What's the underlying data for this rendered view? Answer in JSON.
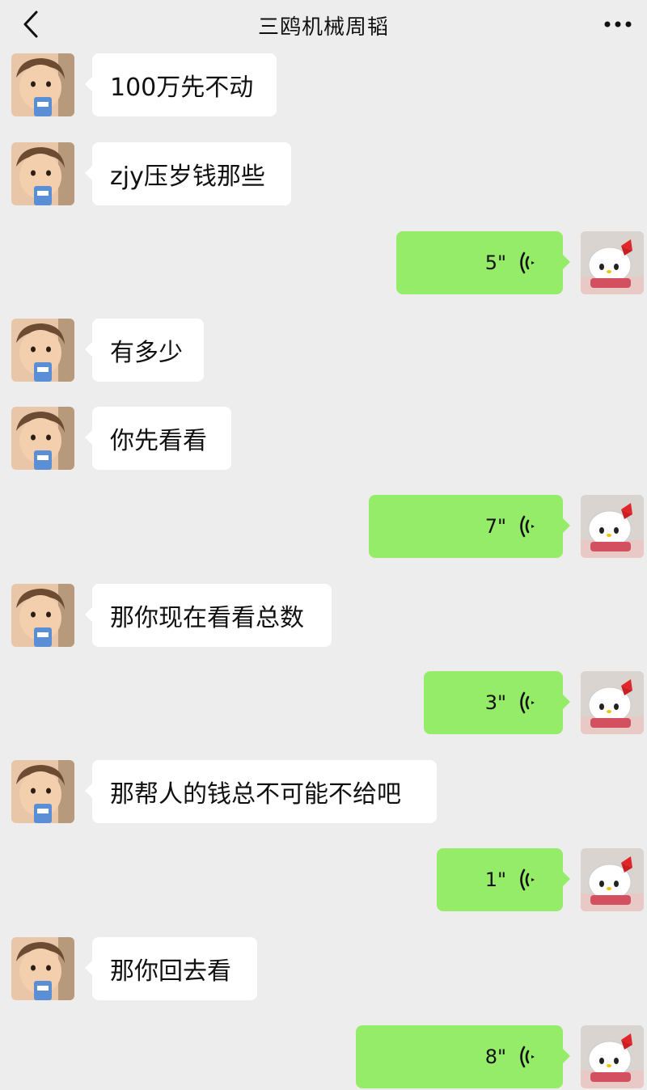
{
  "header": {
    "title": "三鸥机械周韬"
  },
  "messages": [
    {
      "side": "left",
      "type": "text",
      "text": "100万先不动"
    },
    {
      "side": "left",
      "type": "text",
      "text": "zjy压岁钱那些"
    },
    {
      "side": "right",
      "type": "voice",
      "duration": "5\""
    },
    {
      "side": "left",
      "type": "text",
      "text": "有多少"
    },
    {
      "side": "left",
      "type": "text",
      "text": "你先看看"
    },
    {
      "side": "right",
      "type": "voice",
      "duration": "7\""
    },
    {
      "side": "left",
      "type": "text",
      "text": "那你现在看看总数"
    },
    {
      "side": "right",
      "type": "voice",
      "duration": "3\""
    },
    {
      "side": "left",
      "type": "text",
      "text": "那帮人的钱总不可能不给吧"
    },
    {
      "side": "right",
      "type": "voice",
      "duration": "1\""
    },
    {
      "side": "left",
      "type": "text",
      "text": "那你回去看"
    },
    {
      "side": "right",
      "type": "voice",
      "duration": "8\""
    }
  ],
  "icons": {
    "back": "chevron-left-icon",
    "more": "more-dots-icon",
    "voice": "voice-wave-icon"
  },
  "colors": {
    "background": "#ededed",
    "sent_bubble": "#95ec69",
    "received_bubble": "#ffffff"
  }
}
